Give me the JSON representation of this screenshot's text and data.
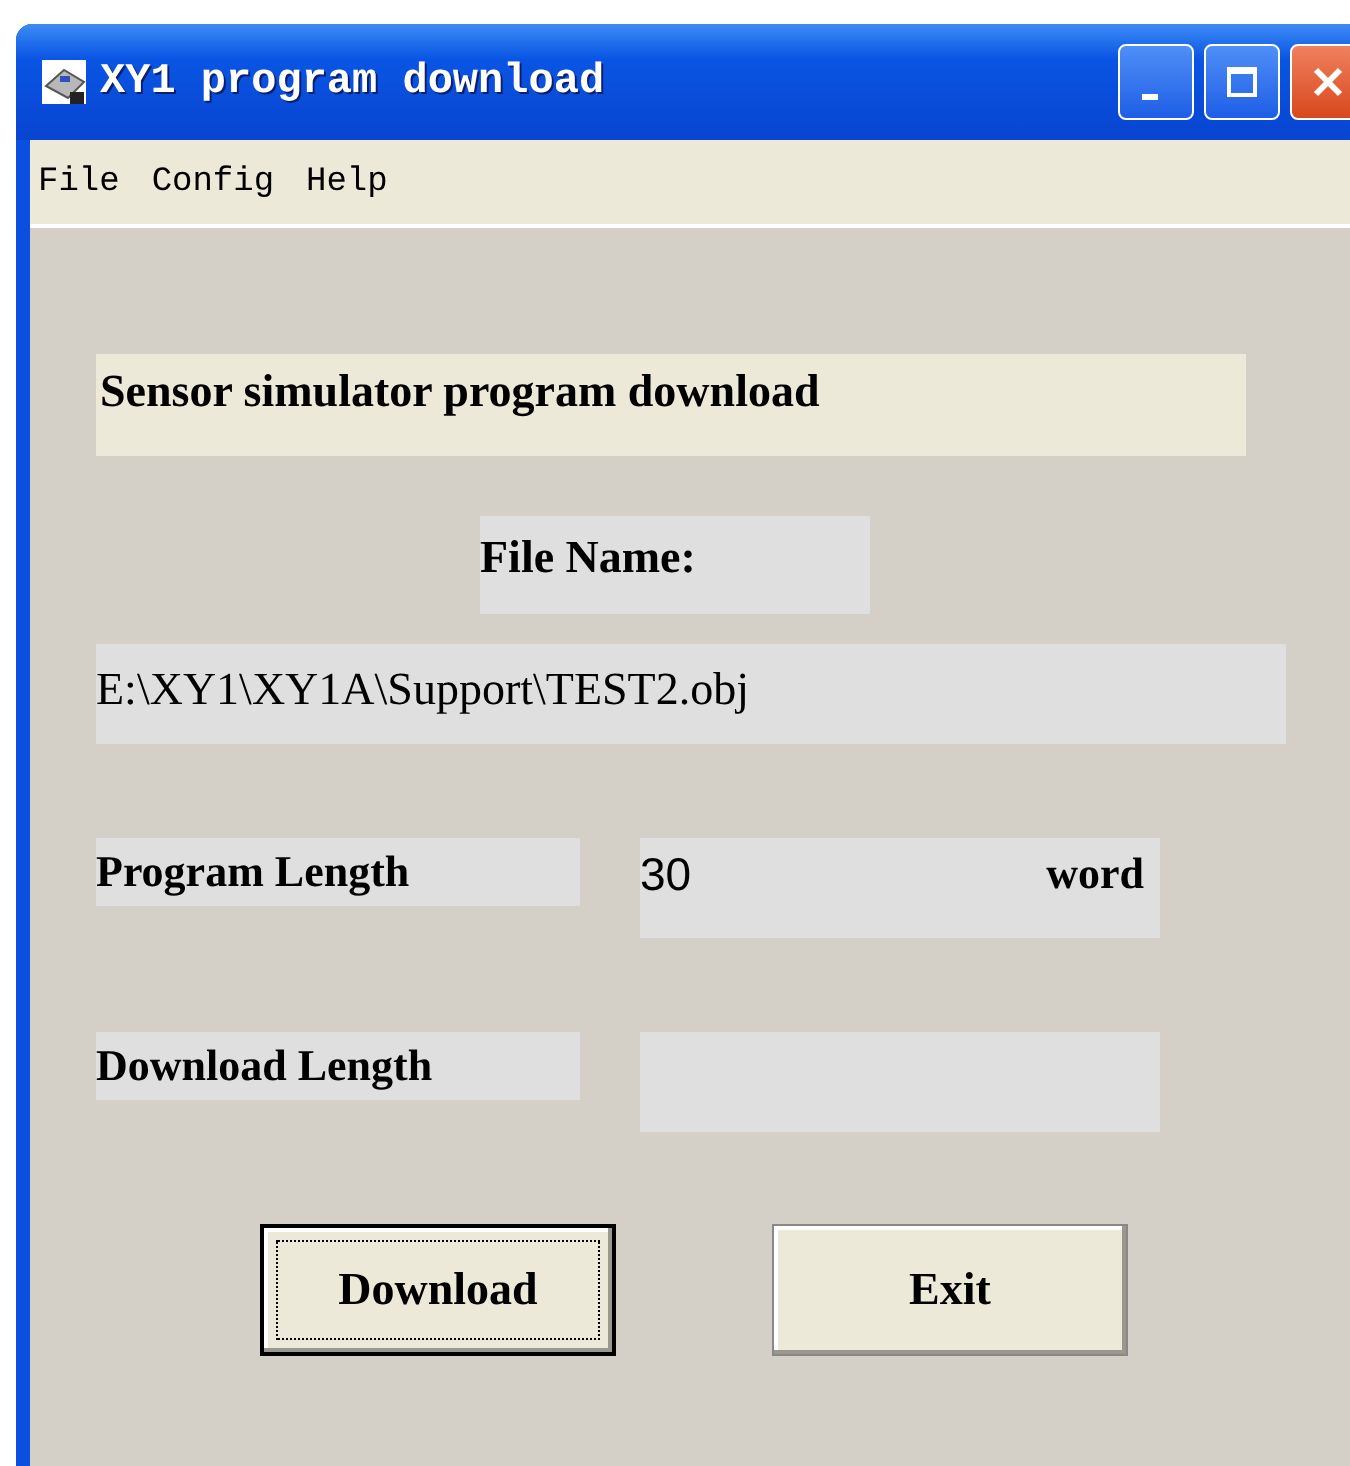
{
  "window": {
    "title": "XY1 program download"
  },
  "menu": [
    "File",
    "Config",
    "Help"
  ],
  "heading": "Sensor simulator program download",
  "file_name_label": "File Name:",
  "file_path": "E:\\XY1\\XY1A\\Support\\TEST2.obj",
  "fields": [
    {
      "label": "Program Length",
      "value": "30",
      "unit": "word"
    },
    {
      "label": "Download Length"
    }
  ],
  "buttons": [
    {
      "label": "Download",
      "focused": true
    },
    {
      "label": "Exit",
      "focused": false
    }
  ]
}
